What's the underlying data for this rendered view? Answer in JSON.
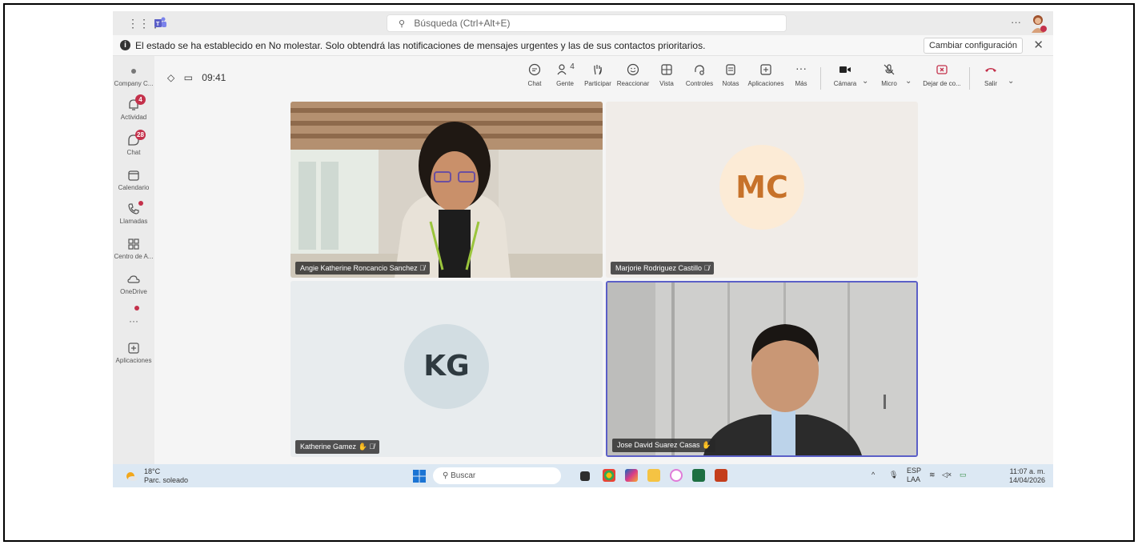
{
  "titlebar": {
    "search_placeholder": "Búsqueda (Ctrl+Alt+E)",
    "more": "···"
  },
  "notification": {
    "text": "El estado se ha establecido en No molestar. Solo obtendrá las notificaciones de mensajes urgentes y las de sus contactos prioritarios.",
    "button": "Cambiar configuración"
  },
  "rail": {
    "items": [
      {
        "label": "Company C...",
        "icon": "company-icon"
      },
      {
        "label": "Actividad",
        "icon": "bell-icon",
        "badge": "4"
      },
      {
        "label": "Chat",
        "icon": "chat-icon",
        "badge": "28"
      },
      {
        "label": "Calendario",
        "icon": "calendar-icon"
      },
      {
        "label": "Llamadas",
        "icon": "phone-icon",
        "dot": true
      },
      {
        "label": "Centro de A...",
        "icon": "apps-grid-icon"
      },
      {
        "label": "OneDrive",
        "icon": "cloud-icon"
      },
      {
        "label": "···",
        "icon": "more-icon",
        "dot": true
      },
      {
        "label": "Aplicaciones",
        "icon": "add-app-icon"
      }
    ]
  },
  "meeting": {
    "timer": "09:41",
    "tools": [
      {
        "label": "Chat",
        "icon": "chat-icon"
      },
      {
        "label": "Gente",
        "icon": "people-icon",
        "count": "4"
      },
      {
        "label": "Participar",
        "icon": "hand-icon"
      },
      {
        "label": "Reaccionar",
        "icon": "smile-icon"
      },
      {
        "label": "Vista",
        "icon": "grid-view-icon"
      },
      {
        "label": "Controles",
        "icon": "controls-icon"
      },
      {
        "label": "Notas",
        "icon": "notes-icon"
      },
      {
        "label": "Aplicaciones",
        "icon": "add-app-icon"
      },
      {
        "label": "Más",
        "icon": "more-icon"
      }
    ],
    "camera": "Cámara",
    "mic": "Micro",
    "share": "Dejar de co...",
    "leave": "Salir"
  },
  "participants": [
    {
      "name": "Angie Katherine Roncancio Sanchez",
      "type": "video"
    },
    {
      "name": "Marjorie Rodriguez Castillo",
      "initials": "MC",
      "type": "avatar"
    },
    {
      "name": "Katherine Gamez",
      "initials": "KG",
      "type": "avatar"
    },
    {
      "name": "Jose David Suarez Casas",
      "type": "video"
    }
  ],
  "taskbar": {
    "temp": "18°C",
    "weather": "Parc. soleado",
    "search": "Buscar",
    "lang1": "ESP",
    "lang2": "LAA",
    "time": "11:07 a. m.",
    "date": "14/04/2026"
  },
  "colors": {
    "accent": "#5b5fc7",
    "badge": "#c4314b",
    "leave": "#c4314b"
  }
}
